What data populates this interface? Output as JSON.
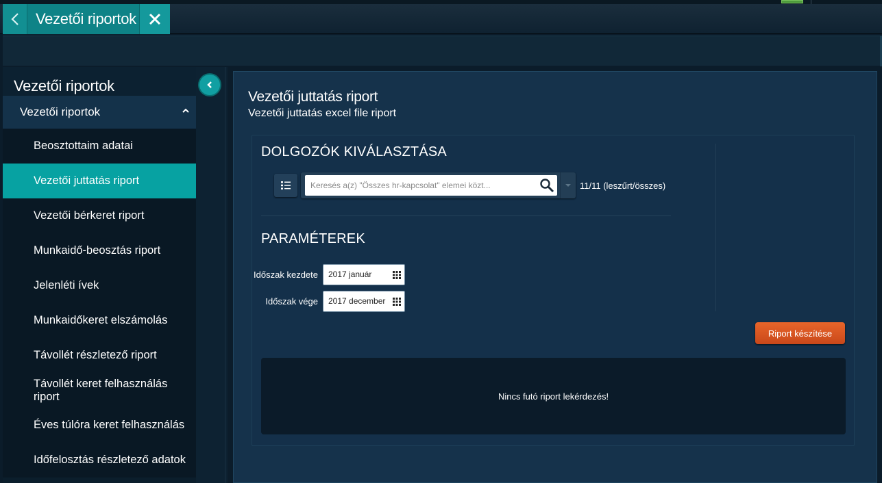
{
  "header": {
    "title": "Vezetői riportok"
  },
  "sidebar": {
    "title": "Vezetői riportok",
    "group_label": "Vezetői riportok",
    "items": [
      {
        "label": "Beosztottaim adatai",
        "active": false
      },
      {
        "label": "Vezetői juttatás riport",
        "active": true
      },
      {
        "label": "Vezetői bérkeret riport",
        "active": false
      },
      {
        "label": "Munkaidő-beosztás riport",
        "active": false
      },
      {
        "label": "Jelenléti ívek",
        "active": false
      },
      {
        "label": "Munkaidőkeret elszámolás",
        "active": false
      },
      {
        "label": "Távollét részletező riport",
        "active": false
      },
      {
        "label": "Távollét keret felhasználás riport",
        "active": false
      },
      {
        "label": "Éves túlóra keret felhasználás",
        "active": false
      },
      {
        "label": "Időfelosztás részletező adatok",
        "active": false
      }
    ]
  },
  "main": {
    "title": "Vezetői juttatás riport",
    "subtitle": "Vezetői juttatás excel file riport",
    "employees": {
      "section_title": "DOLGOZÓK KIVÁLASZTÁSA",
      "search_placeholder": "Keresés a(z) \"Összes hr-kapcsolat\" elemei közt...",
      "search_value": "",
      "count_text": "11/11 (leszűrt/összes)"
    },
    "params": {
      "section_title": "PARAMÉTEREK",
      "start_label": "Időszak kezdete",
      "start_value": "2017 január",
      "end_label": "Időszak vége",
      "end_value": "2017 december"
    },
    "run_button": "Riport készítése",
    "status_text": "Nincs futó riport lekérdezés!"
  },
  "colors": {
    "accent": "#07a2a2",
    "action": "#e05a24",
    "panel": "#15324b"
  }
}
